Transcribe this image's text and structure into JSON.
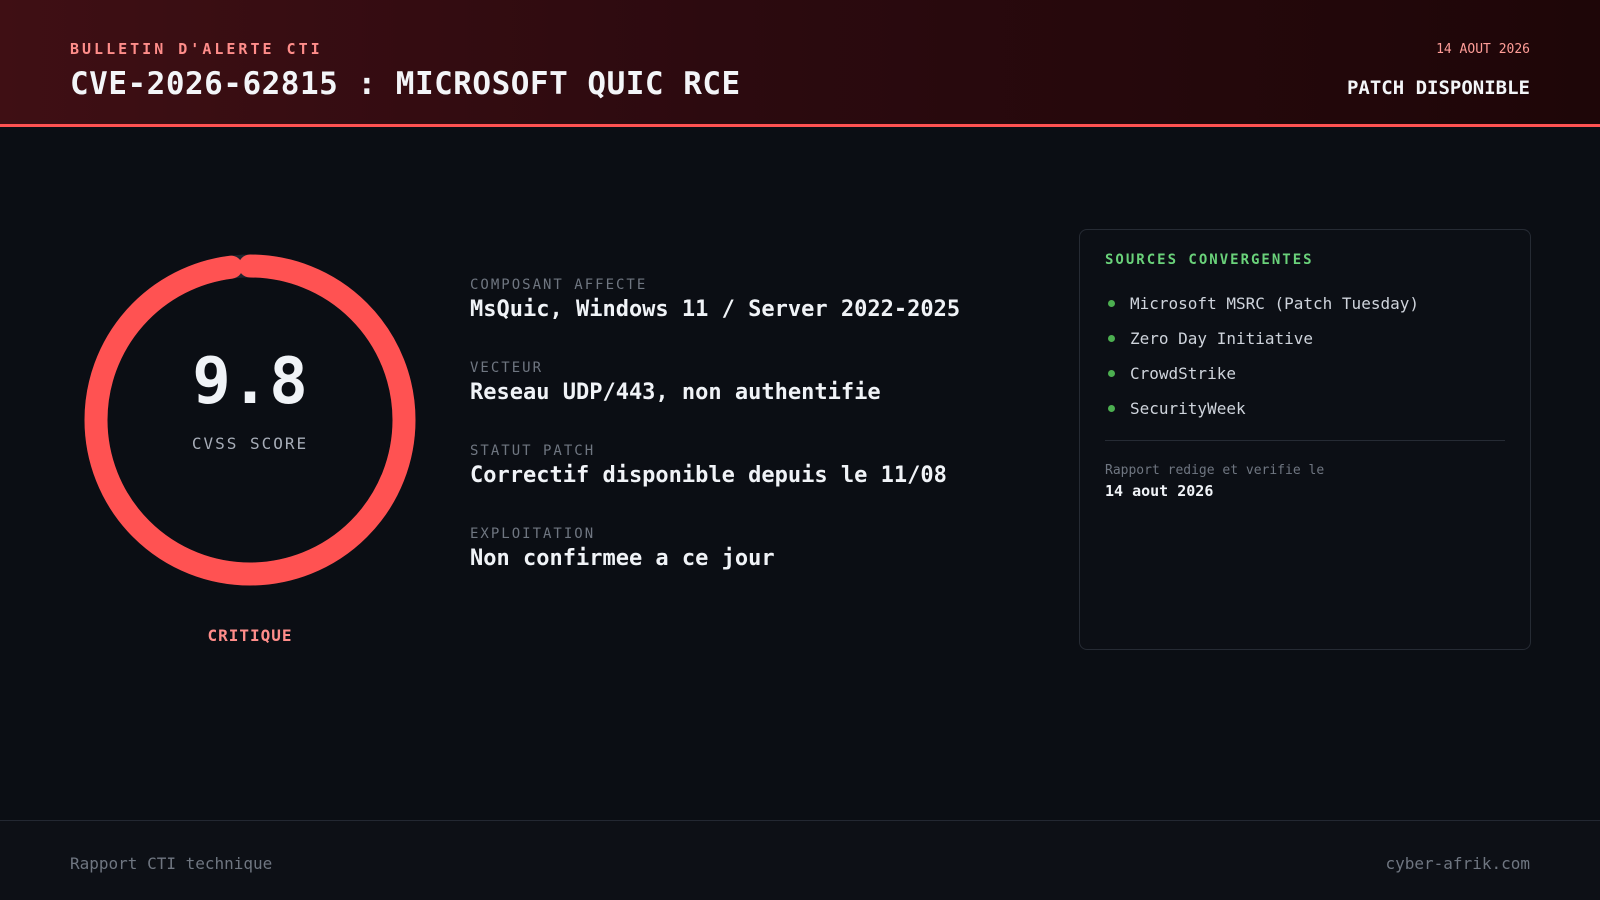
{
  "header": {
    "eyebrow": "BULLETIN D'ALERTE CTI",
    "title": "CVE-2026-62815 : MICROSOFT QUIC RCE",
    "date": "14 AOUT 2026",
    "status": "PATCH DISPONIBLE"
  },
  "gauge": {
    "score": "9.8",
    "score_value": 9.8,
    "score_max": 10,
    "label": "CVSS SCORE",
    "severity": "CRITIQUE",
    "arc_color": "#ff5252",
    "track_color": "#1e252e"
  },
  "facts": [
    {
      "label": "COMPOSANT AFFECTE",
      "value": "MsQuic, Windows 11 / Server 2022-2025"
    },
    {
      "label": "VECTEUR",
      "value": "Reseau UDP/443, non authentifie"
    },
    {
      "label": "STATUT PATCH",
      "value": "Correctif disponible depuis le 11/08"
    },
    {
      "label": "EXPLOITATION",
      "value": "Non confirmee a ce jour"
    }
  ],
  "sources_panel": {
    "title": "SOURCES CONVERGENTES",
    "items": [
      "Microsoft MSRC (Patch Tuesday)",
      "Zero Day Initiative",
      "CrowdStrike",
      "SecurityWeek"
    ],
    "report_label": "Rapport redige et verifie le",
    "report_date": "14 aout 2026"
  },
  "footer": {
    "left": "Rapport CTI technique",
    "right": "cyber-afrik.com"
  },
  "colors": {
    "accent": "#ff5252",
    "eyebrow": "#ff8d8a",
    "source_dot": "#4caf50",
    "panel_title": "#6ad27a"
  }
}
